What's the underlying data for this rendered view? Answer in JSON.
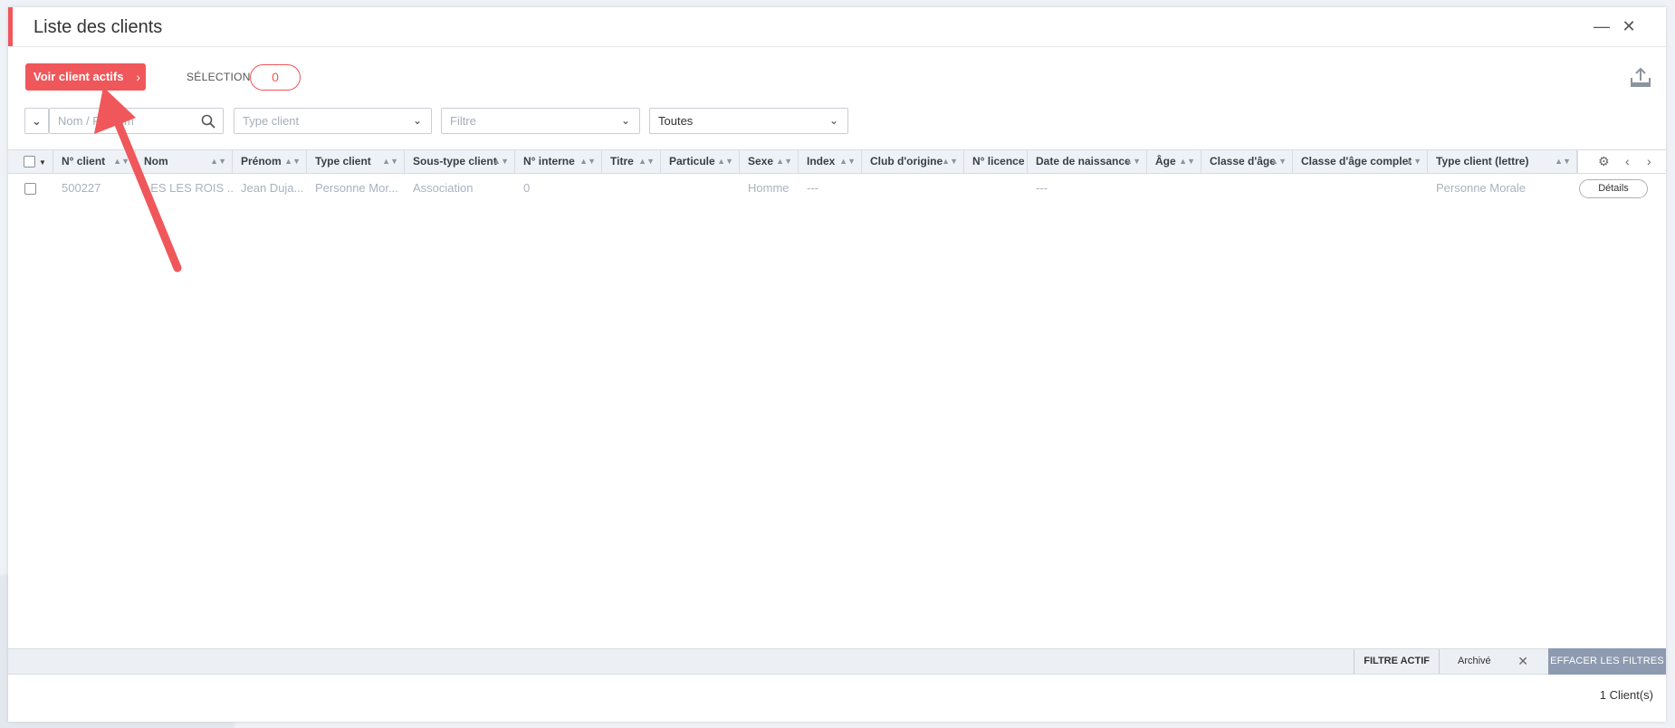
{
  "window": {
    "title": "Liste des clients",
    "minimize_label": "—",
    "close_label": "✕"
  },
  "toolbar": {
    "primary_button": "Voir client actifs",
    "primary_chevron": "›",
    "selection_label": "SÉLECTION",
    "selection_count": "0"
  },
  "filters": {
    "toggle_caret": "⌄",
    "name_placeholder": "Nom / Prénom",
    "type_placeholder": "Type client",
    "filtre_placeholder": "Filtre",
    "scope_value": "Toutes",
    "caret": "⌄"
  },
  "table": {
    "columns": [
      "N° client",
      "Nom",
      "Prénom",
      "Type client",
      "Sous-type client",
      "N° interne",
      "Titre",
      "Particule",
      "Sexe",
      "Index",
      "Club d'origine",
      "N° licence",
      "Date de naissance",
      "Âge",
      "Classe d'âge",
      "Classe d'âge complet",
      "Type client (lettre)"
    ],
    "rows": [
      {
        "cells": [
          "500227",
          "LES LES ROIS ...",
          "Jean Duja...",
          "Personne Mor...",
          "Association",
          "0",
          "",
          "",
          "Homme",
          "---",
          "",
          "",
          "---",
          "",
          "",
          "",
          "Personne Morale"
        ],
        "action": "Détails"
      }
    ]
  },
  "footer": {
    "active_filter_label": "FILTRE ACTIF",
    "active_filter_chip": "Archivé",
    "clear_button": "EFFACER LES FILTRES",
    "count_text": "1 Client(s)"
  },
  "colors": {
    "accent": "#f0575a",
    "clear_button": "#8d9ab0"
  }
}
